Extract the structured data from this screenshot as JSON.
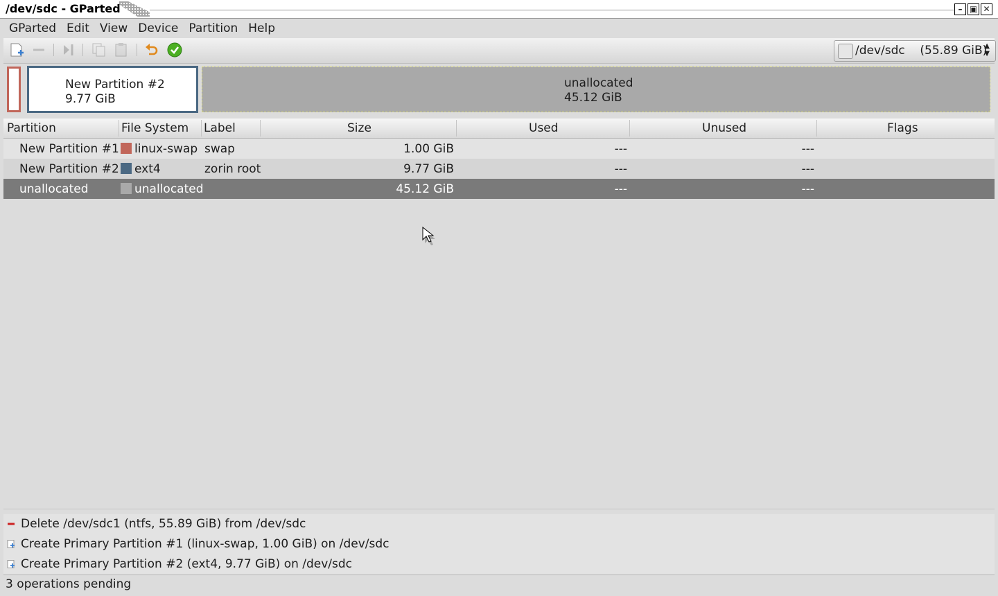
{
  "window": {
    "title": "/dev/sdc - GParted"
  },
  "menu": [
    "GParted",
    "Edit",
    "View",
    "Device",
    "Partition",
    "Help"
  ],
  "toolbar": {
    "icons": [
      "new-icon",
      "delete-icon",
      "resize-move-icon",
      "copy-icon",
      "paste-icon",
      "undo-icon",
      "apply-icon"
    ]
  },
  "device_selector": {
    "device": "/dev/sdc",
    "size": "(55.89 GiB)"
  },
  "graph": {
    "partition2": {
      "name": "New Partition #2",
      "size": "9.77 GiB"
    },
    "unallocated": {
      "name": "unallocated",
      "size": "45.12 GiB"
    }
  },
  "table": {
    "headers": [
      "Partition",
      "File System",
      "Label",
      "Size",
      "Used",
      "Unused",
      "Flags"
    ],
    "rows": [
      {
        "partition": "New Partition #1",
        "filesystem": "linux-swap",
        "fs_color": "#c1665a",
        "label": "swap",
        "size": "1.00 GiB",
        "used": "---",
        "unused": "---",
        "flags": ""
      },
      {
        "partition": "New Partition #2",
        "filesystem": "ext4",
        "fs_color": "#4b6983",
        "label": "zorin root",
        "size": "9.77 GiB",
        "used": "---",
        "unused": "---",
        "flags": ""
      },
      {
        "partition": "unallocated",
        "filesystem": "unallocated",
        "fs_color": "#a9a9a9",
        "label": "",
        "size": "45.12 GiB",
        "used": "---",
        "unused": "---",
        "flags": ""
      }
    ]
  },
  "operations": [
    {
      "icon": "delete-icon",
      "text": "Delete /dev/sdc1 (ntfs, 55.89 GiB) from /dev/sdc"
    },
    {
      "icon": "new-icon",
      "text": "Create Primary Partition #1 (linux-swap, 1.00 GiB) on /dev/sdc"
    },
    {
      "icon": "new-icon",
      "text": "Create Primary Partition #2 (ext4, 9.77 GiB) on /dev/sdc"
    }
  ],
  "status": "3 operations pending"
}
